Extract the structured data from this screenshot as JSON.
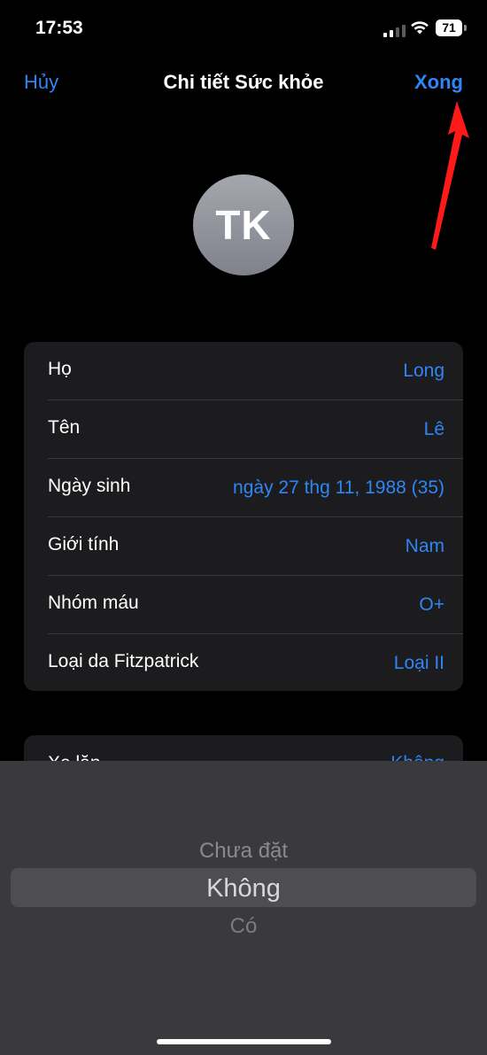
{
  "status_bar": {
    "time": "17:53",
    "battery": "71"
  },
  "nav": {
    "cancel_label": "Hủy",
    "title": "Chi tiết Sức khỏe",
    "done_label": "Xong"
  },
  "profile": {
    "initials": "TK"
  },
  "details": [
    {
      "label": "Họ",
      "value": "Long"
    },
    {
      "label": "Tên",
      "value": "Lê"
    },
    {
      "label": "Ngày sinh",
      "value": "ngày 27 thg 11, 1988 (35)"
    },
    {
      "label": "Giới tính",
      "value": "Nam"
    },
    {
      "label": "Nhóm máu",
      "value": "O+"
    },
    {
      "label": "Loại da Fitzpatrick",
      "value": "Loại II"
    }
  ],
  "wheelchair": {
    "label": "Xe lăn",
    "value": "Không"
  },
  "picker": {
    "option_above": "Chưa đặt",
    "option_selected": "Không",
    "option_below": "Có"
  },
  "colors": {
    "accent": "#2e86f5",
    "annotation_arrow": "#ff1a1a"
  }
}
